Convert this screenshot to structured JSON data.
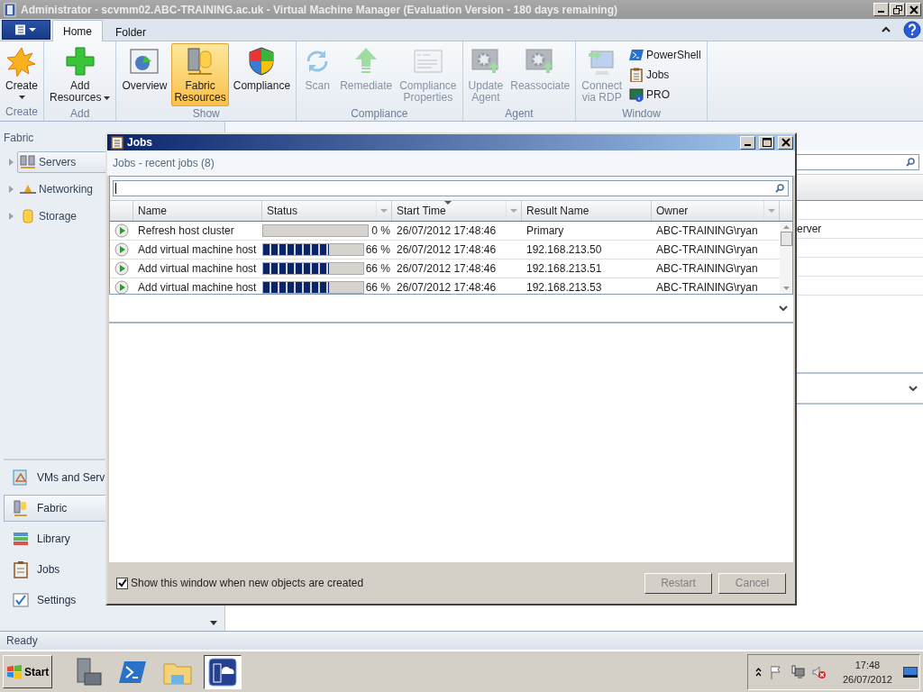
{
  "window": {
    "title": "Administrator - scvmm02.ABC-TRAINING.ac.uk - Virtual Machine Manager (Evaluation Version - 180 days remaining)"
  },
  "ribbon_tabs": [
    {
      "label": "Home",
      "selected": true
    },
    {
      "label": "Folder",
      "selected": false
    }
  ],
  "ribbon_groups": [
    {
      "label": "Create",
      "buttons": [
        {
          "kind": "large",
          "lines": [
            "Create"
          ],
          "dropdown": true,
          "selected": false,
          "disabled": false
        }
      ]
    },
    {
      "label": "Add",
      "buttons": [
        {
          "kind": "large",
          "lines": [
            "Add",
            "Resources"
          ],
          "dropdown": true,
          "selected": false,
          "disabled": false
        }
      ]
    },
    {
      "label": "Show",
      "buttons": [
        {
          "kind": "large",
          "lines": [
            "Overview"
          ],
          "dropdown": false,
          "selected": false,
          "disabled": false
        },
        {
          "kind": "large",
          "lines": [
            "Fabric",
            "Resources"
          ],
          "dropdown": false,
          "selected": true,
          "disabled": false
        },
        {
          "kind": "large",
          "lines": [
            "Compliance"
          ],
          "dropdown": false,
          "selected": false,
          "disabled": false
        }
      ]
    },
    {
      "label": "Compliance",
      "buttons": [
        {
          "kind": "large",
          "lines": [
            "Scan"
          ],
          "dropdown": false,
          "selected": false,
          "disabled": true
        },
        {
          "kind": "large",
          "lines": [
            "Remediate"
          ],
          "dropdown": false,
          "selected": false,
          "disabled": true
        },
        {
          "kind": "large",
          "lines": [
            "Compliance",
            "Properties"
          ],
          "dropdown": false,
          "selected": false,
          "disabled": true
        }
      ]
    },
    {
      "label": "Agent",
      "buttons": [
        {
          "kind": "large",
          "lines": [
            "Update",
            "Agent"
          ],
          "dropdown": false,
          "selected": false,
          "disabled": true
        },
        {
          "kind": "large",
          "lines": [
            "Reassociate"
          ],
          "dropdown": false,
          "selected": false,
          "disabled": true
        }
      ]
    },
    {
      "label": "Window",
      "buttons": [
        {
          "kind": "large",
          "lines": [
            "Connect",
            "via RDP"
          ],
          "dropdown": false,
          "selected": false,
          "disabled": true
        },
        {
          "kind": "small",
          "lines": [
            "PowerShell"
          ],
          "dropdown": false,
          "selected": false,
          "disabled": false
        },
        {
          "kind": "small",
          "lines": [
            "Jobs"
          ],
          "dropdown": false,
          "selected": false,
          "disabled": false
        },
        {
          "kind": "small",
          "lines": [
            "PRO"
          ],
          "dropdown": false,
          "selected": false,
          "disabled": false
        }
      ]
    }
  ],
  "sidebar": {
    "title": "Fabric",
    "tree": [
      {
        "label": "Servers",
        "selected": true,
        "expanded": false
      },
      {
        "label": "Networking",
        "selected": false,
        "expanded": false
      },
      {
        "label": "Storage",
        "selected": false,
        "expanded": false
      }
    ],
    "nav": [
      {
        "label": "VMs and Serv",
        "selected": false
      },
      {
        "label": "Fabric",
        "selected": true
      },
      {
        "label": "Library",
        "selected": false
      },
      {
        "label": "Jobs",
        "selected": false
      },
      {
        "label": "Settings",
        "selected": false
      }
    ]
  },
  "main_pane": {
    "visible_text": "erver"
  },
  "jobs_dialog": {
    "title": "Jobs",
    "heading": "Jobs - recent jobs (8)",
    "columns": [
      {
        "label": "Name",
        "filter": false,
        "sorted": false
      },
      {
        "label": "Status",
        "filter": true,
        "sorted": false
      },
      {
        "label": "Start Time",
        "filter": true,
        "sorted": true
      },
      {
        "label": "Result Name",
        "filter": false,
        "sorted": false
      },
      {
        "label": "Owner",
        "filter": true,
        "sorted": false
      }
    ],
    "rows": [
      {
        "name": "Refresh host cluster",
        "level": 0,
        "progress": "0 %",
        "start_time": "26/07/2012 17:48:46",
        "result_name": "Primary",
        "owner": "ABC-TRAINING\\ryan"
      },
      {
        "name": "Add virtual machine host",
        "level": 0.66,
        "progress": "66 %",
        "start_time": "26/07/2012 17:48:46",
        "result_name": "192.168.213.50",
        "owner": "ABC-TRAINING\\ryan"
      },
      {
        "name": "Add virtual machine host",
        "level": 0.66,
        "progress": "66 %",
        "start_time": "26/07/2012 17:48:46",
        "result_name": "192.168.213.51",
        "owner": "ABC-TRAINING\\ryan"
      },
      {
        "name": "Add virtual machine host",
        "level": 0.66,
        "progress": "66 %",
        "start_time": "26/07/2012 17:48:46",
        "result_name": "192.168.213.53",
        "owner": "ABC-TRAINING\\ryan"
      }
    ],
    "show_checkbox": {
      "label": "Show this window when new objects are created",
      "checked": true
    },
    "buttons": [
      {
        "label": "Restart",
        "disabled": true
      },
      {
        "label": "Cancel",
        "disabled": true
      }
    ]
  },
  "status_bar": {
    "text": "Ready"
  },
  "taskbar": {
    "start": "Start",
    "apps": [
      {
        "selected": false
      },
      {
        "selected": false
      },
      {
        "selected": false
      },
      {
        "selected": true
      }
    ],
    "clock": {
      "time": "17:48",
      "date": "26/07/2012"
    }
  }
}
